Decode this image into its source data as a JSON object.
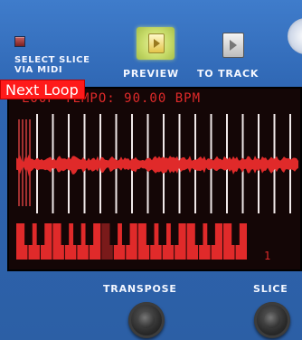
{
  "controls": {
    "select_slice_label_line1": "SELECT SLICE",
    "select_slice_label_line2": "VIA MIDI",
    "preview_label": "PREVIEW",
    "to_track_label": "TO TRACK"
  },
  "tooltip": {
    "text": "Next Loop"
  },
  "display": {
    "tempo_text": "LOOP TEMPO: 90.00 BPM",
    "slice_number": "1",
    "slice_markers": 17,
    "accent_color": "#e02a2a",
    "background_color": "#140606"
  },
  "bottom": {
    "transpose_label": "TRANSPOSE",
    "slice_label": "SLICE"
  }
}
